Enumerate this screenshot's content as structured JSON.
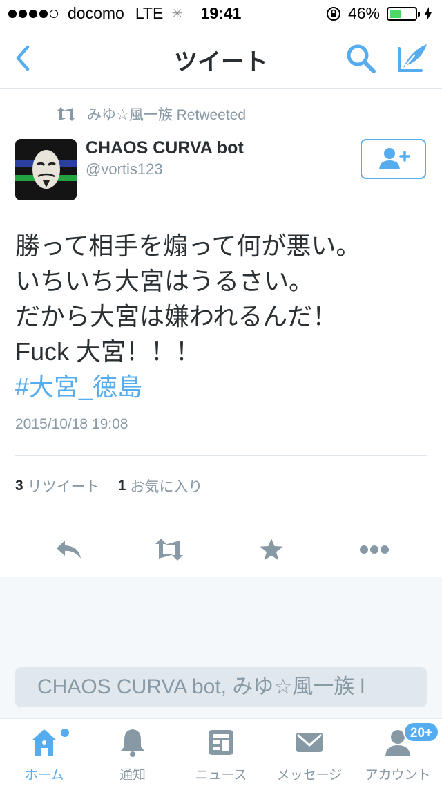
{
  "status_bar": {
    "carrier": "docomo",
    "network": "LTE",
    "time": "19:41",
    "battery_percent": "46%",
    "battery_level": 0.46
  },
  "nav": {
    "title": "ツイート",
    "accent_color": "#55acee"
  },
  "tweet": {
    "retweeted_by": "みゆ☆風一族 Retweeted",
    "user_name": "CHAOS CURVA bot",
    "user_handle": "@vortis123",
    "text_lines": [
      "勝って相手を煽って何が悪い。",
      "いちいち大宮はうるさい。",
      "だから大宮は嫌われるんだ！",
      "Fuck 大宮！！！"
    ],
    "hashtag": "#大宮_徳島",
    "timestamp": "2015/10/18 19:08",
    "retweet_count": "3",
    "retweet_label": "リツイート",
    "favorite_count": "1",
    "favorite_label": "お気に入り"
  },
  "reply": {
    "placeholder": "CHAOS CURVA bot, みゆ☆風一族 l"
  },
  "tabs": [
    {
      "label": "ホーム",
      "icon": "home-icon",
      "active": true
    },
    {
      "label": "通知",
      "icon": "bell-icon",
      "active": false
    },
    {
      "label": "ニュース",
      "icon": "news-icon",
      "active": false
    },
    {
      "label": "メッセージ",
      "icon": "envelope-icon",
      "active": false
    },
    {
      "label": "アカウント",
      "icon": "person-icon",
      "active": false,
      "badge": "20+"
    }
  ]
}
